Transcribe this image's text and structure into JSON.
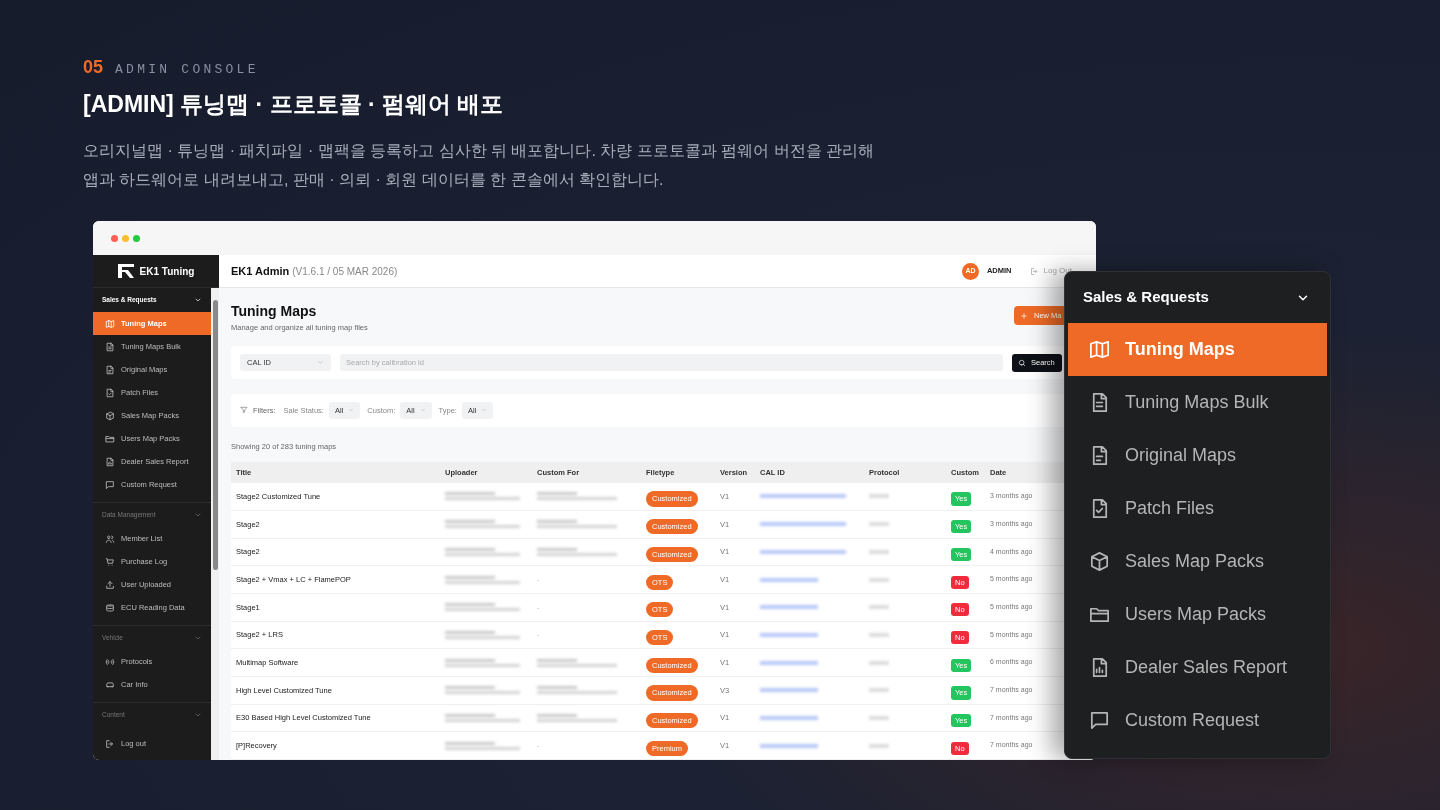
{
  "slide": {
    "number": "05",
    "eyebrow": "ADMIN CONSOLE",
    "title": "[ADMIN] 튜닝맵 · 프로토콜 · 펌웨어 배포",
    "description": "오리지널맵 · 튜닝맵 · 패치파일 · 맵팩을 등록하고 심사한 뒤 배포합니다. 차량 프로토콜과 펌웨어 버전을 관리해\n앱과 하드웨어로 내려보내고, 판매 · 의뢰 · 회원 데이터를 한 콘솔에서 확인합니다."
  },
  "app": {
    "brand": "EK1 Tuning",
    "header_title": "EK1 Admin",
    "version": "(V1.6.1 / 05 MAR 2026)",
    "avatar": "AD",
    "user": "ADMIN",
    "logout": "Log Out",
    "sidebar": [
      {
        "title": "Sales & Requests",
        "active": true,
        "items": [
          {
            "label": "Tuning Maps",
            "selected": true
          },
          {
            "label": "Tuning Maps Bulk",
            "selected": false
          },
          {
            "label": "Original Maps",
            "selected": false
          },
          {
            "label": "Patch Files",
            "selected": false
          },
          {
            "label": "Sales Map Packs",
            "selected": false
          },
          {
            "label": "Users Map Packs",
            "selected": false
          },
          {
            "label": "Dealer Sales Report",
            "selected": false
          },
          {
            "label": "Custom Request",
            "selected": false
          }
        ]
      },
      {
        "title": "Data Management",
        "active": false,
        "items": [
          {
            "label": "Member List",
            "selected": false
          },
          {
            "label": "Purchase Log",
            "selected": false
          },
          {
            "label": "User Uploaded",
            "selected": false
          },
          {
            "label": "ECU Reading Data",
            "selected": false
          }
        ]
      },
      {
        "title": "Vehicle",
        "active": false,
        "items": [
          {
            "label": "Protocols",
            "selected": false
          },
          {
            "label": "Car Info",
            "selected": false
          }
        ]
      },
      {
        "title": "Content",
        "active": false
      }
    ],
    "sidebar_footer": "Log out",
    "page": {
      "title": "Tuning Maps",
      "subtitle": "Manage and organize all tuning map files",
      "new_button": "New Ma",
      "search_select": "CAL ID",
      "search_placeholder": "Search by calibration id",
      "search_button": "Search",
      "filters_label": "Filters:",
      "filters": [
        {
          "label": "Sale Status:",
          "value": "All"
        },
        {
          "label": "Custom:",
          "value": "All"
        },
        {
          "label": "Type:",
          "value": "All"
        }
      ],
      "count": "Showing 20 of 283 tuning maps",
      "columns": [
        "Title",
        "Uploader",
        "Custom For",
        "Filetype",
        "Version",
        "CAL ID",
        "Protocol",
        "Custom",
        "Date"
      ],
      "rows": [
        {
          "title": "Stage2 Customized Tune",
          "filetype": "Customized",
          "version": "V1",
          "custom": {
            "label": "Yes",
            "on": true
          },
          "date": "3 months ago"
        },
        {
          "title": "Stage2",
          "filetype": "Customized",
          "version": "V1",
          "custom": {
            "label": "Yes",
            "on": true
          },
          "date": "3 months ago"
        },
        {
          "title": "Stage2",
          "filetype": "Customized",
          "version": "V1",
          "custom": {
            "label": "Yes",
            "on": true
          },
          "date": "4 months ago"
        },
        {
          "title": "Stage2 + Vmax + LC + FlamePOP",
          "custom_for": "-",
          "filetype": "OTS",
          "version": "V1",
          "custom": {
            "label": "No",
            "on": false
          },
          "date": "5 months ago"
        },
        {
          "title": "Stage1",
          "custom_for": "-",
          "filetype": "OTS",
          "version": "V1",
          "custom": {
            "label": "No",
            "on": false
          },
          "date": "5 months ago"
        },
        {
          "title": "Stage2 + LRS",
          "custom_for": "-",
          "filetype": "OTS",
          "version": "V1",
          "custom": {
            "label": "No",
            "on": false
          },
          "date": "5 months ago"
        },
        {
          "title": "Multimap Software",
          "filetype": "Customized",
          "version": "V1",
          "custom": {
            "label": "Yes",
            "on": true
          },
          "date": "6 months ago"
        },
        {
          "title": "High Level Customized Tune",
          "filetype": "Customized",
          "version": "V3",
          "custom": {
            "label": "Yes",
            "on": true
          },
          "date": "7 months ago"
        },
        {
          "title": "E30 Based High Level Customized Tune",
          "filetype": "Customized",
          "version": "V1",
          "custom": {
            "label": "Yes",
            "on": true
          },
          "date": "7 months ago"
        },
        {
          "title": "[P]Recovery",
          "custom_for": "-",
          "filetype": "Premium",
          "version": "V1",
          "custom": {
            "label": "No",
            "on": false
          },
          "date": "7 months ago"
        }
      ]
    }
  },
  "zoom_panel": {
    "title": "Sales & Requests",
    "items": [
      {
        "label": "Tuning Maps",
        "selected": true
      },
      {
        "label": "Tuning Maps Bulk",
        "selected": false
      },
      {
        "label": "Original Maps",
        "selected": false
      },
      {
        "label": "Patch Files",
        "selected": false
      },
      {
        "label": "Sales Map Packs",
        "selected": false
      },
      {
        "label": "Users Map Packs",
        "selected": false
      },
      {
        "label": "Dealer Sales Report",
        "selected": false
      },
      {
        "label": "Custom Request",
        "selected": false
      }
    ]
  }
}
